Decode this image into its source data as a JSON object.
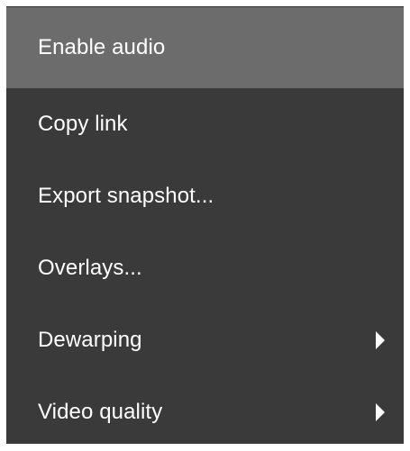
{
  "context_menu": {
    "items": [
      {
        "label": "Enable audio",
        "highlighted": true,
        "has_submenu": false
      },
      {
        "label": "Copy link",
        "highlighted": false,
        "has_submenu": false
      },
      {
        "label": "Export snapshot...",
        "highlighted": false,
        "has_submenu": false
      },
      {
        "label": "Overlays...",
        "highlighted": false,
        "has_submenu": false
      },
      {
        "label": "Dewarping",
        "highlighted": false,
        "has_submenu": true,
        "submenu_icon": "chevron-right-icon"
      },
      {
        "label": "Video quality",
        "highlighted": false,
        "has_submenu": true,
        "submenu_icon": "chevron-right-icon"
      }
    ],
    "colors": {
      "background": "#3a3a3a",
      "highlight": "#6c6c6c",
      "text": "#ffffff"
    }
  }
}
